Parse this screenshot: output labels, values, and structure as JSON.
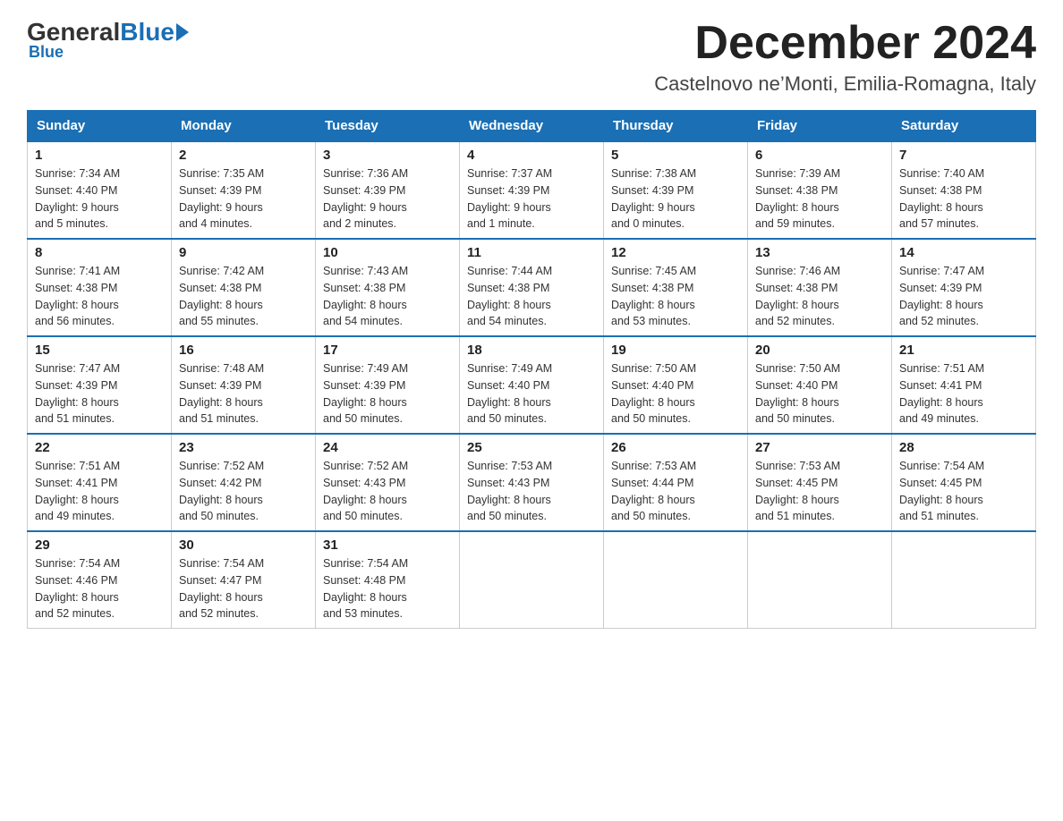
{
  "logo": {
    "general": "General",
    "blue": "Blue",
    "subtitle": "Blue"
  },
  "title": {
    "month": "December 2024",
    "location": "Castelnovo ne’Monti, Emilia-Romagna, Italy"
  },
  "days_of_week": [
    "Sunday",
    "Monday",
    "Tuesday",
    "Wednesday",
    "Thursday",
    "Friday",
    "Saturday"
  ],
  "weeks": [
    [
      {
        "day": "1",
        "sunrise": "7:34 AM",
        "sunset": "4:40 PM",
        "daylight": "9 hours and 5 minutes."
      },
      {
        "day": "2",
        "sunrise": "7:35 AM",
        "sunset": "4:39 PM",
        "daylight": "9 hours and 4 minutes."
      },
      {
        "day": "3",
        "sunrise": "7:36 AM",
        "sunset": "4:39 PM",
        "daylight": "9 hours and 2 minutes."
      },
      {
        "day": "4",
        "sunrise": "7:37 AM",
        "sunset": "4:39 PM",
        "daylight": "9 hours and 1 minute."
      },
      {
        "day": "5",
        "sunrise": "7:38 AM",
        "sunset": "4:39 PM",
        "daylight": "9 hours and 0 minutes."
      },
      {
        "day": "6",
        "sunrise": "7:39 AM",
        "sunset": "4:38 PM",
        "daylight": "8 hours and 59 minutes."
      },
      {
        "day": "7",
        "sunrise": "7:40 AM",
        "sunset": "4:38 PM",
        "daylight": "8 hours and 57 minutes."
      }
    ],
    [
      {
        "day": "8",
        "sunrise": "7:41 AM",
        "sunset": "4:38 PM",
        "daylight": "8 hours and 56 minutes."
      },
      {
        "day": "9",
        "sunrise": "7:42 AM",
        "sunset": "4:38 PM",
        "daylight": "8 hours and 55 minutes."
      },
      {
        "day": "10",
        "sunrise": "7:43 AM",
        "sunset": "4:38 PM",
        "daylight": "8 hours and 54 minutes."
      },
      {
        "day": "11",
        "sunrise": "7:44 AM",
        "sunset": "4:38 PM",
        "daylight": "8 hours and 54 minutes."
      },
      {
        "day": "12",
        "sunrise": "7:45 AM",
        "sunset": "4:38 PM",
        "daylight": "8 hours and 53 minutes."
      },
      {
        "day": "13",
        "sunrise": "7:46 AM",
        "sunset": "4:38 PM",
        "daylight": "8 hours and 52 minutes."
      },
      {
        "day": "14",
        "sunrise": "7:47 AM",
        "sunset": "4:39 PM",
        "daylight": "8 hours and 52 minutes."
      }
    ],
    [
      {
        "day": "15",
        "sunrise": "7:47 AM",
        "sunset": "4:39 PM",
        "daylight": "8 hours and 51 minutes."
      },
      {
        "day": "16",
        "sunrise": "7:48 AM",
        "sunset": "4:39 PM",
        "daylight": "8 hours and 51 minutes."
      },
      {
        "day": "17",
        "sunrise": "7:49 AM",
        "sunset": "4:39 PM",
        "daylight": "8 hours and 50 minutes."
      },
      {
        "day": "18",
        "sunrise": "7:49 AM",
        "sunset": "4:40 PM",
        "daylight": "8 hours and 50 minutes."
      },
      {
        "day": "19",
        "sunrise": "7:50 AM",
        "sunset": "4:40 PM",
        "daylight": "8 hours and 50 minutes."
      },
      {
        "day": "20",
        "sunrise": "7:50 AM",
        "sunset": "4:40 PM",
        "daylight": "8 hours and 50 minutes."
      },
      {
        "day": "21",
        "sunrise": "7:51 AM",
        "sunset": "4:41 PM",
        "daylight": "8 hours and 49 minutes."
      }
    ],
    [
      {
        "day": "22",
        "sunrise": "7:51 AM",
        "sunset": "4:41 PM",
        "daylight": "8 hours and 49 minutes."
      },
      {
        "day": "23",
        "sunrise": "7:52 AM",
        "sunset": "4:42 PM",
        "daylight": "8 hours and 50 minutes."
      },
      {
        "day": "24",
        "sunrise": "7:52 AM",
        "sunset": "4:43 PM",
        "daylight": "8 hours and 50 minutes."
      },
      {
        "day": "25",
        "sunrise": "7:53 AM",
        "sunset": "4:43 PM",
        "daylight": "8 hours and 50 minutes."
      },
      {
        "day": "26",
        "sunrise": "7:53 AM",
        "sunset": "4:44 PM",
        "daylight": "8 hours and 50 minutes."
      },
      {
        "day": "27",
        "sunrise": "7:53 AM",
        "sunset": "4:45 PM",
        "daylight": "8 hours and 51 minutes."
      },
      {
        "day": "28",
        "sunrise": "7:54 AM",
        "sunset": "4:45 PM",
        "daylight": "8 hours and 51 minutes."
      }
    ],
    [
      {
        "day": "29",
        "sunrise": "7:54 AM",
        "sunset": "4:46 PM",
        "daylight": "8 hours and 52 minutes."
      },
      {
        "day": "30",
        "sunrise": "7:54 AM",
        "sunset": "4:47 PM",
        "daylight": "8 hours and 52 minutes."
      },
      {
        "day": "31",
        "sunrise": "7:54 AM",
        "sunset": "4:48 PM",
        "daylight": "8 hours and 53 minutes."
      },
      null,
      null,
      null,
      null
    ]
  ],
  "labels": {
    "sunrise": "Sunrise:",
    "sunset": "Sunset:",
    "daylight": "Daylight:"
  },
  "colors": {
    "header_bg": "#1a6fb5",
    "header_text": "#ffffff",
    "row_border": "#1a6fb5"
  }
}
